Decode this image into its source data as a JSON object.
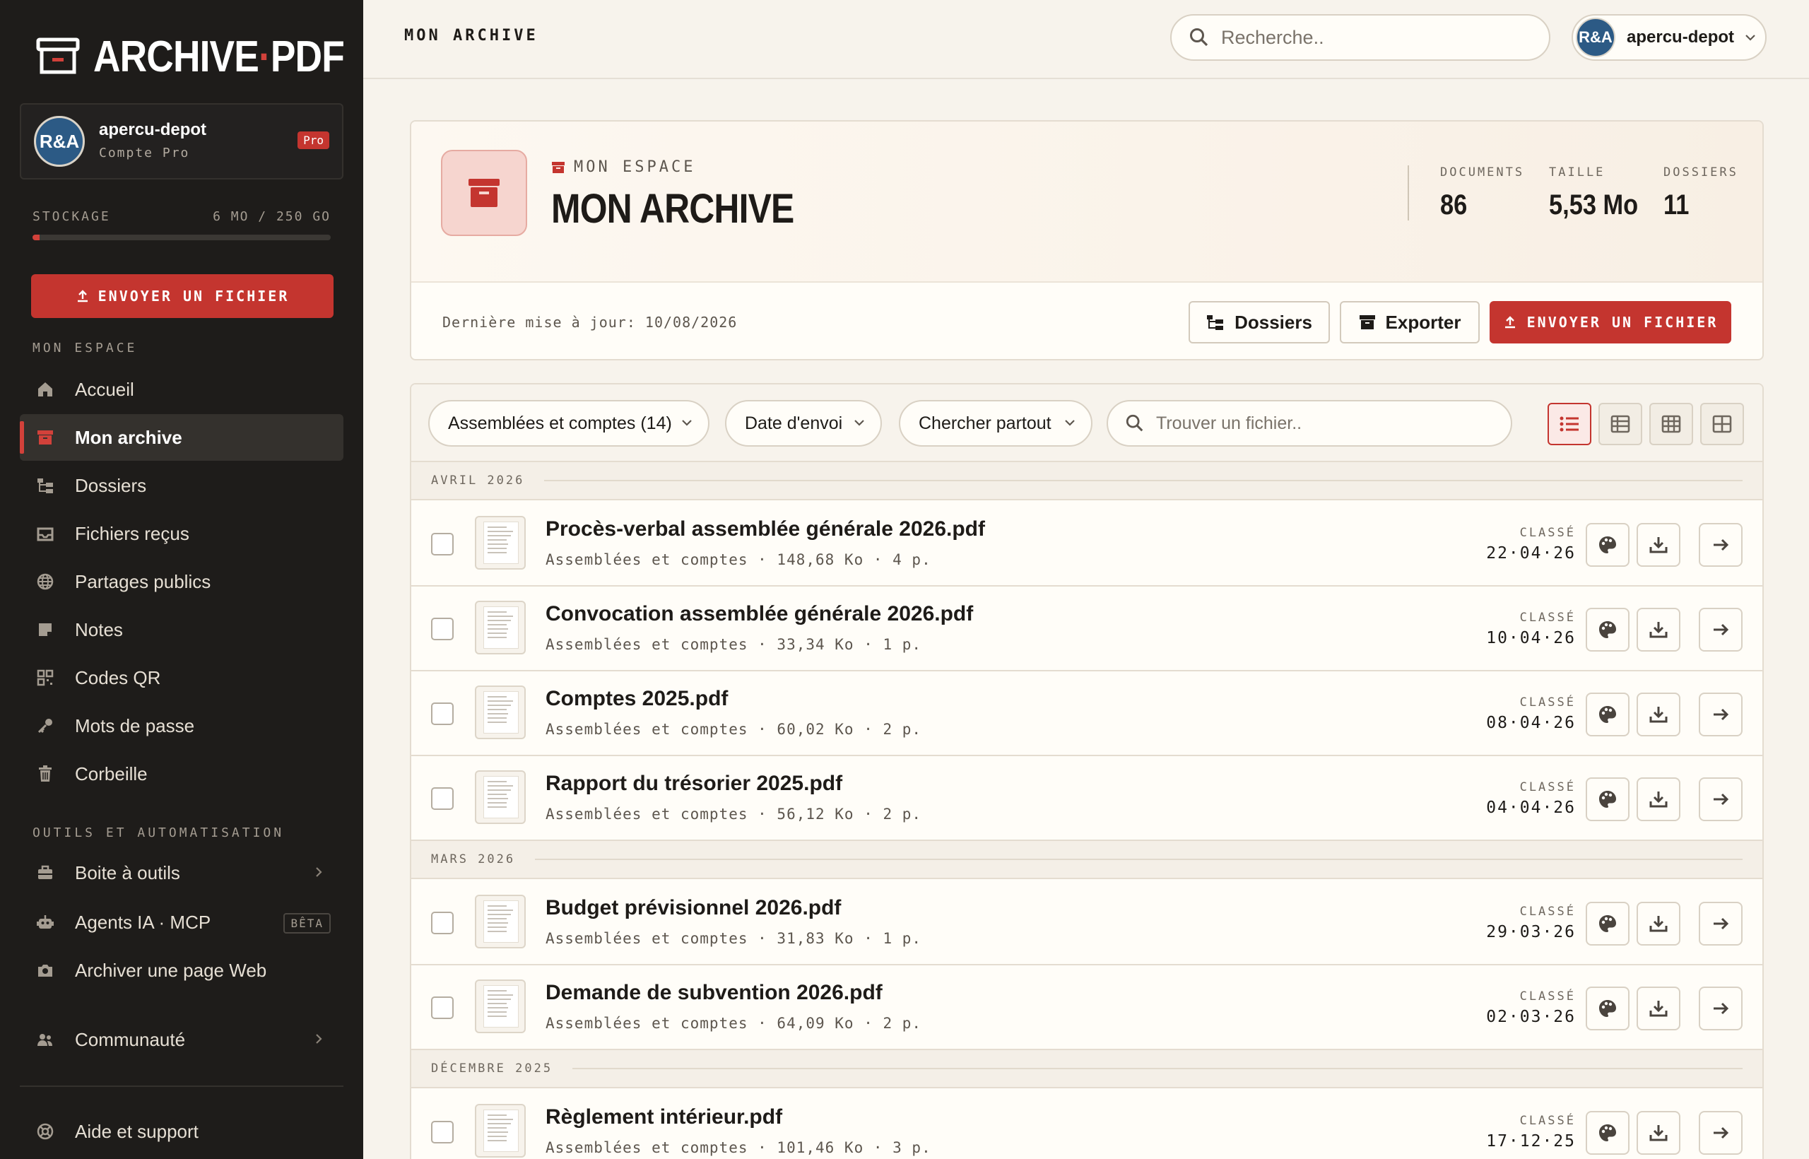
{
  "brand": {
    "name_part1": "ARCHIVE",
    "dot": "·",
    "name_part2": "PDF",
    "accent": "#c4352f"
  },
  "account": {
    "avatar_text": "R&A",
    "name": "apercu-depot",
    "plan": "Compte Pro",
    "badge": "Pro"
  },
  "storage": {
    "label": "STOCKAGE",
    "value": "6 MO / 250 GO",
    "used_fraction": 0.024
  },
  "sidebar": {
    "upload_label": "ENVOYER UN FICHIER",
    "section1": "MON ESPACE",
    "items": [
      {
        "label": "Accueil",
        "icon": "home-icon"
      },
      {
        "label": "Mon archive",
        "icon": "archive-icon"
      },
      {
        "label": "Dossiers",
        "icon": "folder-tree-icon"
      },
      {
        "label": "Fichiers reçus",
        "icon": "inbox-icon"
      },
      {
        "label": "Partages publics",
        "icon": "globe-icon"
      },
      {
        "label": "Notes",
        "icon": "note-icon"
      },
      {
        "label": "Codes QR",
        "icon": "qr-code-icon"
      },
      {
        "label": "Mots de passe",
        "icon": "key-icon"
      },
      {
        "label": "Corbeille",
        "icon": "trash-icon"
      }
    ],
    "section2": "OUTILS ET AUTOMATISATION",
    "tools": [
      {
        "label": "Boite à outils",
        "icon": "toolbox-icon"
      },
      {
        "label": "Agents IA · MCP",
        "icon": "robot-icon",
        "badge": "BÊTA"
      },
      {
        "label": "Archiver une page Web",
        "icon": "camera-icon"
      }
    ],
    "community": "Communauté",
    "help": "Aide et support"
  },
  "topbar": {
    "breadcrumb": "MON ARCHIVE",
    "search_placeholder": "Recherche..",
    "user": "apercu-depot",
    "avatar_text": "R&A"
  },
  "header": {
    "eyebrow": "MON ESPACE",
    "title": "MON ARCHIVE",
    "stats": [
      {
        "label": "DOCUMENTS",
        "value": "86"
      },
      {
        "label": "TAILLE",
        "value": "5,53 Mo"
      },
      {
        "label": "DOSSIERS",
        "value": "11"
      }
    ],
    "updated": "Dernière mise à jour: 10/08/2026",
    "btn_folders": "Dossiers",
    "btn_export": "Exporter",
    "btn_upload": "ENVOYER UN FICHIER"
  },
  "filters": {
    "category": "Assemblées et comptes (14)",
    "sort": "Date d'envoi",
    "scope": "Chercher partout",
    "find_placeholder": "Trouver un fichier.."
  },
  "groups": [
    {
      "label": "AVRIL 2026",
      "files": [
        {
          "name": "Procès-verbal assemblée générale 2026.pdf",
          "meta": "Assemblées et comptes · 148,68 Ko · 4 p.",
          "classe": "CLASSÉ",
          "date": "22·04·26"
        },
        {
          "name": "Convocation assemblée générale 2026.pdf",
          "meta": "Assemblées et comptes · 33,34 Ko · 1 p.",
          "classe": "CLASSÉ",
          "date": "10·04·26"
        },
        {
          "name": "Comptes 2025.pdf",
          "meta": "Assemblées et comptes · 60,02 Ko · 2 p.",
          "classe": "CLASSÉ",
          "date": "08·04·26"
        },
        {
          "name": "Rapport du trésorier 2025.pdf",
          "meta": "Assemblées et comptes · 56,12 Ko · 2 p.",
          "classe": "CLASSÉ",
          "date": "04·04·26"
        }
      ]
    },
    {
      "label": "MARS 2026",
      "files": [
        {
          "name": "Budget prévisionnel 2026.pdf",
          "meta": "Assemblées et comptes · 31,83 Ko · 1 p.",
          "classe": "CLASSÉ",
          "date": "29·03·26"
        },
        {
          "name": "Demande de subvention 2026.pdf",
          "meta": "Assemblées et comptes · 64,09 Ko · 2 p.",
          "classe": "CLASSÉ",
          "date": "02·03·26"
        }
      ]
    },
    {
      "label": "DÉCEMBRE 2025",
      "files": [
        {
          "name": "Règlement intérieur.pdf",
          "meta": "Assemblées et comptes · 101,46 Ko · 3 p.",
          "classe": "CLASSÉ",
          "date": "17·12·25"
        }
      ]
    }
  ]
}
